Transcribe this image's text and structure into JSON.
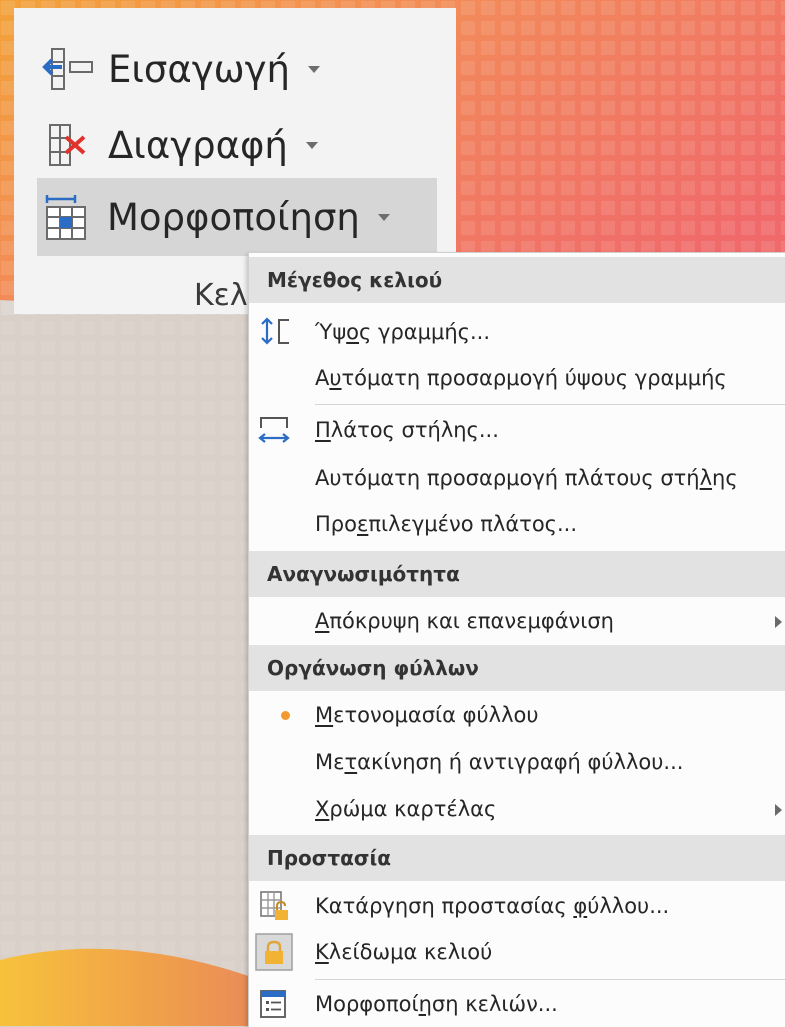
{
  "ribbon": {
    "insert_label": "Εισαγωγή",
    "delete_label": "Διαγραφή",
    "format_label": "Μορφοποίηση",
    "group_label": "Κελ"
  },
  "menu": {
    "cell_size": {
      "header": "Μέγεθος κελιού",
      "row_height": {
        "pre": "Ύψ",
        "key": "ο",
        "post": "ς γραμμής..."
      },
      "autofit_row": {
        "pre": "Α",
        "key": "υ",
        "post": "τόματη προσαρμογή ύψους γραμμής"
      },
      "column_width": {
        "pre": "",
        "key": "Π",
        "post": "λάτος στήλης..."
      },
      "autofit_column": {
        "pre": "Αυτόματη προσαρμογή πλάτους στή",
        "key": "λ",
        "post": "ης"
      },
      "default_width": {
        "pre": "Προ",
        "key": "ε",
        "post": "πιλεγμένο πλάτος..."
      }
    },
    "visibility": {
      "header": "Αναγνωσιμότητα",
      "hide_unhide": {
        "pre": "",
        "key": "Α",
        "post": "πόκρυψη και επανεμφάνιση"
      }
    },
    "organize": {
      "header": "Οργάνωση φύλλων",
      "rename": {
        "pre": "",
        "key": "Μ",
        "post": "ετονομασία φύλλου"
      },
      "move_copy": {
        "pre": "Με",
        "key": "τ",
        "post": "ακίνηση ή αντιγραφή φύλλου..."
      },
      "tab_color": {
        "pre": "",
        "key": "Χ",
        "post": "ρώμα καρτέλας"
      }
    },
    "protection": {
      "header": "Προστασία",
      "unprotect": {
        "pre": "Κατάργηση προστασίας ",
        "key": "φ",
        "post": "ύλλου..."
      },
      "lock_cell": {
        "pre": "",
        "key": "Κ",
        "post": "λείδωμα κελιού"
      },
      "format_cells": {
        "pre": "Μορφοποί",
        "key": "η",
        "post": "ση κελιών..."
      }
    }
  },
  "colors": {
    "accent_orange": "#f29a2e",
    "delete_red": "#e0332c",
    "icon_blue": "#2b6cc4",
    "highlight_gray": "#d6d6d6",
    "section_gray": "#e2e2e2"
  }
}
